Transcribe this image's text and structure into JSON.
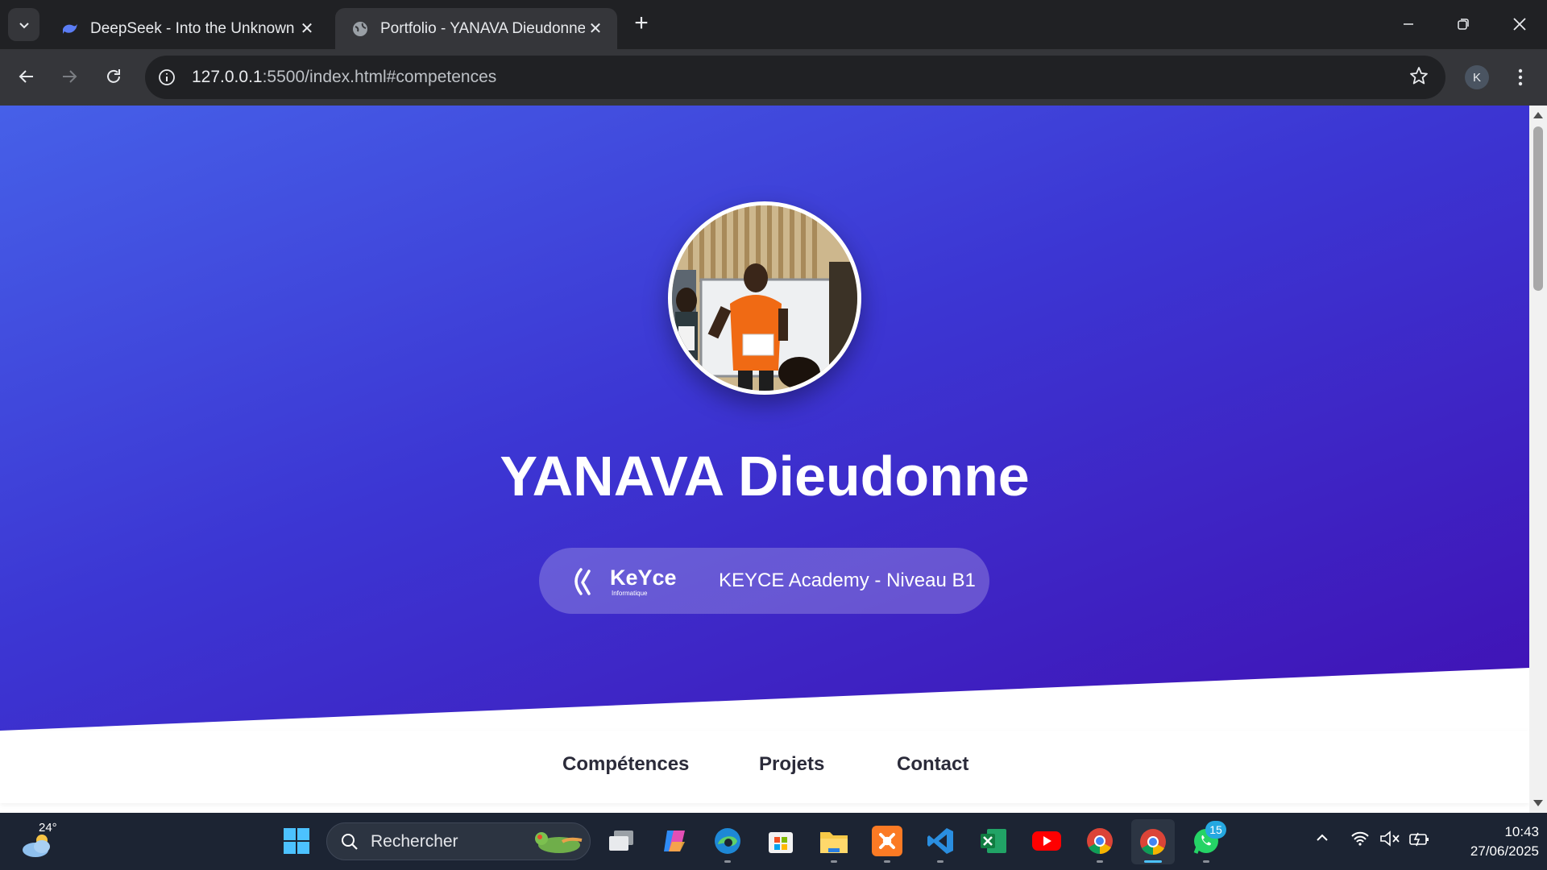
{
  "browser": {
    "tabs": [
      {
        "title": "DeepSeek - Into the Unknown",
        "favicon": "deepseek-whale-icon",
        "active": false
      },
      {
        "title": "Portfolio - YANAVA Dieudonne",
        "favicon": "globe-icon",
        "active": true
      }
    ],
    "url_host": "127.0.0.1",
    "url_rest": ":5500/index.html#competences",
    "profile_initial": "K"
  },
  "hero": {
    "name": "YANAVA Dieudonne",
    "school_logo_text": "KeYce",
    "school_logo_sub": "Informatique",
    "badge_label": "KEYCE Academy - Niveau B1",
    "gradient": [
      "#4660e8",
      "#3c36d3",
      "#4011b4"
    ]
  },
  "nav": {
    "links": [
      "Compétences",
      "Projets",
      "Contact"
    ]
  },
  "taskbar": {
    "temperature": "24°",
    "search_placeholder": "Rechercher",
    "whatsapp_badge": "15",
    "time": "10:43",
    "date": "27/06/2025"
  }
}
